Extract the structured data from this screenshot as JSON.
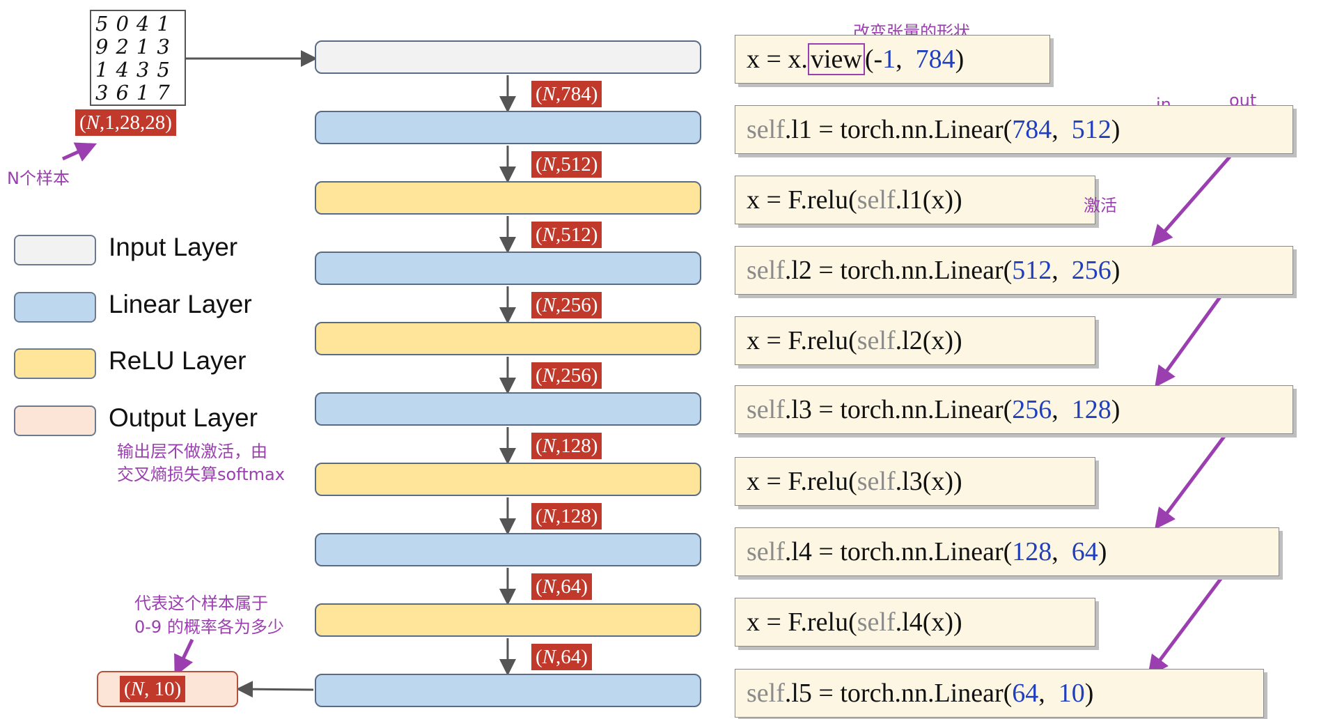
{
  "colors": {
    "input": "#f2f2f2",
    "linear": "#bdd7ee",
    "relu": "#fee599",
    "output": "#fce4d6",
    "shape_badge": "#c0392b",
    "annotation": "#9b3fb0",
    "code_number": "#1f3fbf"
  },
  "mnist_digits": [
    "5041",
    "9213",
    "1435",
    "3617"
  ],
  "input_shape": {
    "n": "N",
    "rest": ",1,28,28"
  },
  "notes": {
    "n_samples": "N个样本",
    "reshape": "改变张量的形状",
    "activation": "激活",
    "in": "in",
    "out": "out",
    "output_line1": "输出层不做激活，由",
    "output_line2": "交叉熵损失算softmax",
    "prob_line1": "代表这个样本属于",
    "prob_line2": "0-9 的概率各为多少"
  },
  "legend": [
    {
      "label": "Input Layer",
      "color": "#f2f2f2"
    },
    {
      "label": "Linear Layer",
      "color": "#bdd7ee"
    },
    {
      "label": "ReLU Layer",
      "color": "#fee599"
    },
    {
      "label": "Output Layer",
      "color": "#fce4d6"
    }
  ],
  "layers": [
    "input",
    "linear",
    "relu",
    "linear",
    "relu",
    "linear",
    "relu",
    "linear",
    "relu",
    "linear"
  ],
  "shapes": [
    {
      "n": "N",
      "rest": ",784"
    },
    {
      "n": "N",
      "rest": ",512"
    },
    {
      "n": "N",
      "rest": ",512"
    },
    {
      "n": "N",
      "rest": ",256"
    },
    {
      "n": "N",
      "rest": ",256"
    },
    {
      "n": "N",
      "rest": ",128"
    },
    {
      "n": "N",
      "rest": ",128"
    },
    {
      "n": "N",
      "rest": ",64"
    },
    {
      "n": "N",
      "rest": ",64"
    }
  ],
  "output_shape": {
    "n": "N",
    "rest": ", 10"
  },
  "code": {
    "view_pre": "x = x.",
    "view_fn": "view",
    "view_mid": "(-",
    "view_a": "1",
    "view_sep": ",  ",
    "view_b": "784",
    "view_end": ")",
    "linear": [
      {
        "pre": "self",
        "name": ".l1 = torch.nn.Linear(",
        "in": "784",
        "sep": ",  ",
        "out": "512",
        "end": ")"
      },
      {
        "pre": "self",
        "name": ".l2 = torch.nn.Linear(",
        "in": "512",
        "sep": ",  ",
        "out": "256",
        "end": ")"
      },
      {
        "pre": "self",
        "name": ".l3 = torch.nn.Linear(",
        "in": "256",
        "sep": ",  ",
        "out": "128",
        "end": ")"
      },
      {
        "pre": "self",
        "name": ".l4 = torch.nn.Linear(",
        "in": "128",
        "sep": ",  ",
        "out": "64",
        "end": ")"
      },
      {
        "pre": "self",
        "name": ".l5 = torch.nn.Linear(",
        "in": "64",
        "sep": ",  ",
        "out": "10",
        "end": ")"
      }
    ],
    "relu": [
      {
        "pre": "x = F.relu(",
        "slf": "self",
        "post": ".l1(x))"
      },
      {
        "pre": "x = F.relu(",
        "slf": "self",
        "post": ".l2(x))"
      },
      {
        "pre": "x = F.relu(",
        "slf": "self",
        "post": ".l3(x))"
      },
      {
        "pre": "x = F.relu(",
        "slf": "self",
        "post": ".l4(x))"
      }
    ]
  }
}
